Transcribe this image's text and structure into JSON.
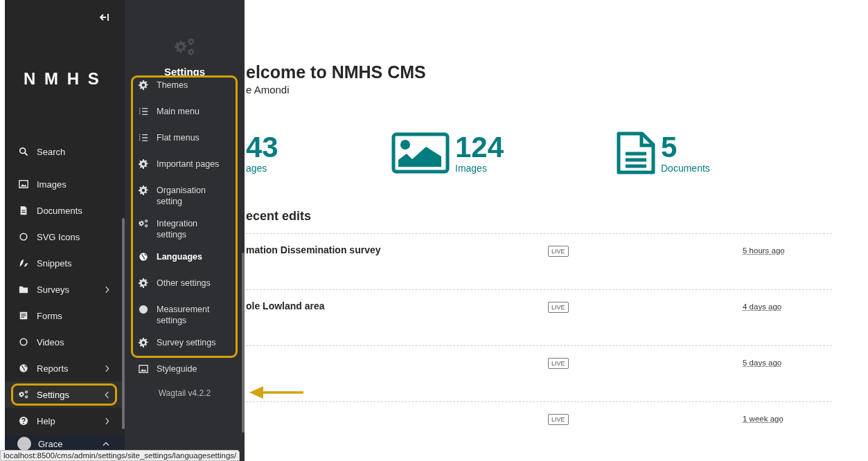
{
  "sidebar": {
    "logo": "N M H S",
    "items": [
      {
        "label": "Search",
        "has_submenu": false,
        "expanded": false,
        "selected": false
      },
      {
        "label": "Images",
        "has_submenu": false,
        "expanded": false,
        "selected": false
      },
      {
        "label": "Documents",
        "has_submenu": false,
        "expanded": false,
        "selected": false
      },
      {
        "label": "SVG Icons",
        "has_submenu": false,
        "expanded": false,
        "selected": false
      },
      {
        "label": "Snippets",
        "has_submenu": false,
        "expanded": false,
        "selected": false
      },
      {
        "label": "Surveys",
        "has_submenu": true,
        "expanded": false,
        "selected": false
      },
      {
        "label": "Forms",
        "has_submenu": false,
        "expanded": false,
        "selected": false
      },
      {
        "label": "Videos",
        "has_submenu": false,
        "expanded": false,
        "selected": false
      },
      {
        "label": "Reports",
        "has_submenu": true,
        "expanded": false,
        "selected": false
      },
      {
        "label": "Settings",
        "has_submenu": true,
        "expanded": true,
        "selected": true
      },
      {
        "label": "Help",
        "has_submenu": true,
        "expanded": false,
        "selected": false
      }
    ],
    "user": {
      "name": "Grace"
    }
  },
  "submenu": {
    "title": "Settings",
    "items": [
      {
        "label": "Themes",
        "highlighted": false
      },
      {
        "label": "Main menu",
        "highlighted": false
      },
      {
        "label": "Flat menus",
        "highlighted": false
      },
      {
        "label": "Important pages",
        "highlighted": false
      },
      {
        "label": "Organisation setting",
        "highlighted": false
      },
      {
        "label": "Integration settings",
        "highlighted": false
      },
      {
        "label": "Languages",
        "highlighted": true
      },
      {
        "label": "Other settings",
        "highlighted": false
      },
      {
        "label": "Measurement settings",
        "highlighted": false
      },
      {
        "label": "Survey settings",
        "highlighted": false
      },
      {
        "label": "Styleguide",
        "highlighted": false
      }
    ],
    "footer": "Wagtail v4.2.2"
  },
  "main": {
    "title": "elcome to NMHS CMS",
    "subtitle": "e Amondi",
    "stats": [
      {
        "value": "43",
        "label": "ages"
      },
      {
        "value": "124",
        "label": "Images"
      },
      {
        "value": "5",
        "label": "Documents"
      }
    ],
    "recent_heading": "ecent edits",
    "rows": [
      {
        "title": "mation Dissemination survey",
        "status": "LIVE",
        "time": "5 hours ago"
      },
      {
        "title": "ole Lowland area",
        "status": "LIVE",
        "time": "4 days ago"
      },
      {
        "title": "",
        "status": "LIVE",
        "time": "5 days ago"
      },
      {
        "title": "",
        "status": "LIVE",
        "time": "1 week ago"
      }
    ]
  },
  "status_bar": {
    "url": "localhost:8500/cms/admin/settings/site_settings/languagesettings/"
  }
}
